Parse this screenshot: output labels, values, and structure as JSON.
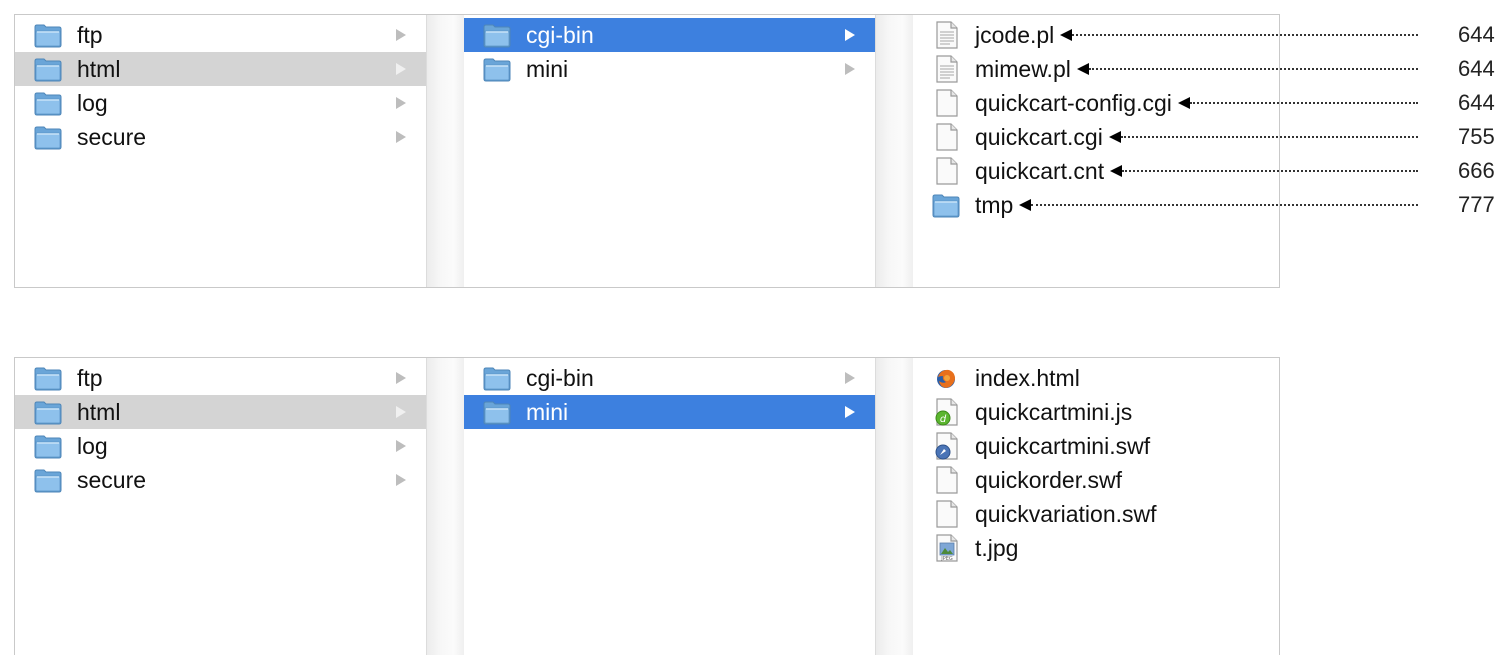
{
  "top": {
    "col1": [
      {
        "label": "ftp",
        "icon": "folder-icon",
        "arrow": true,
        "sel": ""
      },
      {
        "label": "html",
        "icon": "folder-icon",
        "arrow": true,
        "sel": "inactive"
      },
      {
        "label": "log",
        "icon": "folder-icon",
        "arrow": true,
        "sel": ""
      },
      {
        "label": "secure",
        "icon": "folder-icon",
        "arrow": true,
        "sel": ""
      }
    ],
    "col2": [
      {
        "label": "cgi-bin",
        "icon": "folder-icon",
        "arrow": true,
        "sel": "active"
      },
      {
        "label": "mini",
        "icon": "folder-icon",
        "arrow": true,
        "sel": ""
      }
    ],
    "col3": [
      {
        "label": "jcode.pl",
        "icon": "text-document-icon",
        "arrow": false,
        "sel": "",
        "permission": "644"
      },
      {
        "label": "mimew.pl",
        "icon": "text-document-icon",
        "arrow": false,
        "sel": "",
        "permission": "644"
      },
      {
        "label": "quickcart-config.cgi",
        "icon": "blank-document-icon",
        "arrow": false,
        "sel": "",
        "permission": "644"
      },
      {
        "label": "quickcart.cgi",
        "icon": "blank-document-icon",
        "arrow": false,
        "sel": "",
        "permission": "755"
      },
      {
        "label": "quickcart.cnt",
        "icon": "blank-document-icon",
        "arrow": false,
        "sel": "",
        "permission": "666"
      },
      {
        "label": "tmp",
        "icon": "folder-icon",
        "arrow": false,
        "sel": "",
        "permission": "777"
      }
    ]
  },
  "bottom": {
    "col1": [
      {
        "label": "ftp",
        "icon": "folder-icon",
        "arrow": true,
        "sel": ""
      },
      {
        "label": "html",
        "icon": "folder-icon",
        "arrow": true,
        "sel": "inactive"
      },
      {
        "label": "log",
        "icon": "folder-icon",
        "arrow": true,
        "sel": ""
      },
      {
        "label": "secure",
        "icon": "folder-icon",
        "arrow": true,
        "sel": ""
      }
    ],
    "col2": [
      {
        "label": "cgi-bin",
        "icon": "folder-icon",
        "arrow": true,
        "sel": ""
      },
      {
        "label": "mini",
        "icon": "folder-icon",
        "arrow": true,
        "sel": "active"
      }
    ],
    "col3": [
      {
        "label": "index.html",
        "icon": "firefox-document-icon",
        "arrow": false,
        "sel": ""
      },
      {
        "label": "quickcartmini.js",
        "icon": "dreamweaver-document-icon",
        "arrow": false,
        "sel": ""
      },
      {
        "label": "quickcartmini.swf",
        "icon": "safari-document-icon",
        "arrow": false,
        "sel": ""
      },
      {
        "label": "quickorder.swf",
        "icon": "blank-document-icon",
        "arrow": false,
        "sel": ""
      },
      {
        "label": "quickvariation.swf",
        "icon": "blank-document-icon",
        "arrow": false,
        "sel": ""
      },
      {
        "label": "t.jpg",
        "icon": "image-document-icon",
        "arrow": false,
        "sel": ""
      }
    ]
  },
  "colors": {
    "selection_active": "#3d80df",
    "selection_inactive": "#d4d4d4",
    "folder_blue": "#8ec1ec"
  }
}
